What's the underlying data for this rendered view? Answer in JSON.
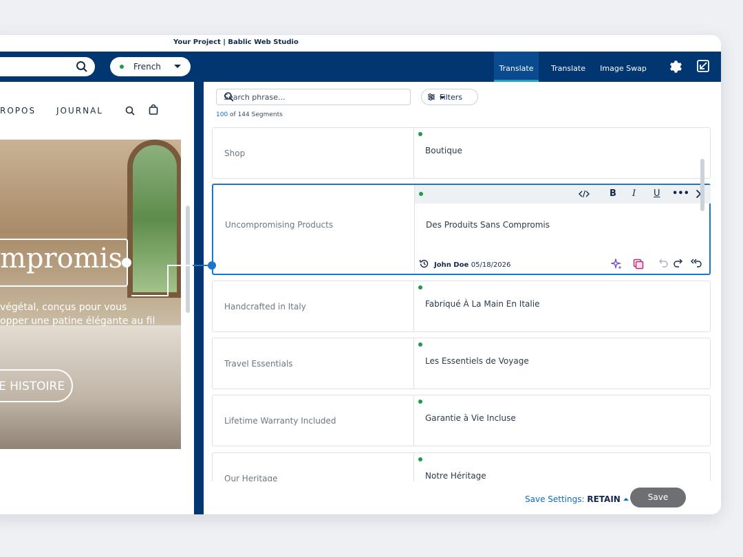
{
  "titlebar": {
    "project": "Your Project",
    "separator": "|",
    "app": "Bablic Web Studio"
  },
  "topbar": {
    "language": "French",
    "tabs": [
      {
        "label": "Translate",
        "active": true
      },
      {
        "label": "Translate",
        "active": false
      },
      {
        "label": "Image Swap",
        "active": false
      }
    ],
    "icons": [
      "search-icon",
      "gear-icon",
      "exit-editor-icon"
    ]
  },
  "site": {
    "nav": [
      "ROPOS",
      "JOURNAL"
    ],
    "hero_title": "mpromis",
    "hero_text": [
      "végétal, conçus pour vous",
      "opper une patine élégante au fil"
    ],
    "hero_button": "E HISTOIRE"
  },
  "panel": {
    "search_placeholder": "Search phrase...",
    "filters_label": "Filters",
    "count_current": "100",
    "count_rest": " of 144 Segments",
    "segments": [
      {
        "source": "Shop",
        "target": "Boutique"
      },
      {
        "source": "Uncompromising Products",
        "target": "Des Produits Sans Compromis",
        "active": true,
        "user": "John Doe",
        "date": "05/18/2026"
      },
      {
        "source": "Handcrafted in Italy",
        "target": "Fabriqué À La Main En Italie"
      },
      {
        "source": "Travel Essentials",
        "target": "Les Essentiels de Voyage"
      },
      {
        "source": "Lifetime Warranty Included",
        "target": "Garantie à Vie Incluse"
      },
      {
        "source": "Our Heritage",
        "target": "Notre Héritage"
      }
    ],
    "toolbar": {
      "bold": "B",
      "italic": "I",
      "underline": "U",
      "more": "•••"
    }
  },
  "footer": {
    "save_settings_label": "Save Settings:",
    "save_settings_value": "RETAIN",
    "save_label": "Save"
  },
  "colors": {
    "navy": "#023671",
    "accent": "#1877c9",
    "status_green": "#1e9b4c"
  }
}
